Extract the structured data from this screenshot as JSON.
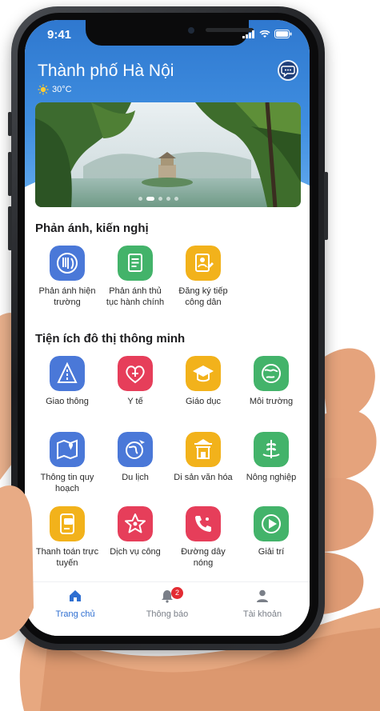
{
  "status_bar": {
    "time": "9:41"
  },
  "header": {
    "city": "Thành phố Hà Nội",
    "temperature": "30°C"
  },
  "banner": {
    "slide_count": 5,
    "active_index": 1
  },
  "section_feedback": {
    "title": "Phản ánh, kiến nghị",
    "items": [
      {
        "label": "Phản ánh hiện trường",
        "icon": "scene-report-icon",
        "color": "#4a78d8"
      },
      {
        "label": "Phản ánh thủ tục hành chính",
        "icon": "document-icon",
        "color": "#43b36a"
      },
      {
        "label": "Đăng ký tiếp công dân",
        "icon": "citizen-registration-icon",
        "color": "#f2b21b"
      }
    ]
  },
  "section_smart_city": {
    "title": "Tiện ích đô thị thông minh",
    "items": [
      {
        "label": "Giao thông",
        "icon": "traffic-icon",
        "color": "#4a78d8"
      },
      {
        "label": "Y tế",
        "icon": "health-icon",
        "color": "#e63e5a"
      },
      {
        "label": "Giáo dục",
        "icon": "education-icon",
        "color": "#f2b21b"
      },
      {
        "label": "Môi trường",
        "icon": "environment-icon",
        "color": "#43b36a"
      },
      {
        "label": "Thông tin quy hoạch",
        "icon": "planning-map-icon",
        "color": "#4a78d8"
      },
      {
        "label": "Du lịch",
        "icon": "tourism-icon",
        "color": "#4a78d8"
      },
      {
        "label": "Di sản văn hóa",
        "icon": "heritage-icon",
        "color": "#f2b21b"
      },
      {
        "label": "Nông nghiệp",
        "icon": "agriculture-icon",
        "color": "#43b36a"
      },
      {
        "label": "Thanh toán trực tuyến",
        "icon": "payment-icon",
        "color": "#f2b21b"
      },
      {
        "label": "Dịch vụ công",
        "icon": "public-service-icon",
        "color": "#e63e5a"
      },
      {
        "label": "Đường dây nóng",
        "icon": "hotline-icon",
        "color": "#e63e5a"
      },
      {
        "label": "Giải trí",
        "icon": "entertainment-icon",
        "color": "#43b36a"
      }
    ]
  },
  "tabbar": {
    "home": "Trang chủ",
    "notifications": "Thông báo",
    "notifications_badge": "2",
    "account": "Tài khoản",
    "active_color": "#2f6fd1",
    "inactive_color": "#7a7f88"
  }
}
